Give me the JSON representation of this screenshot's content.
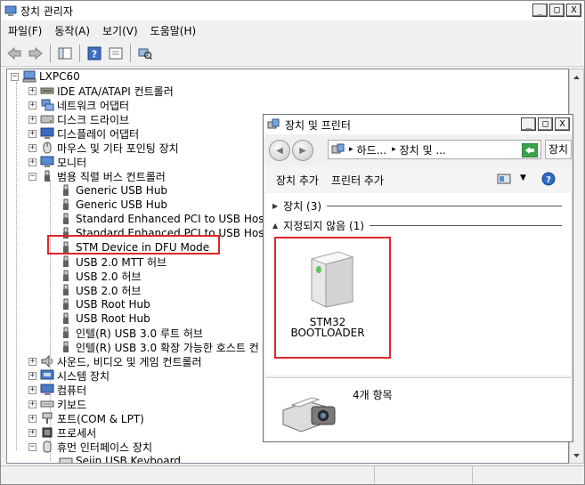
{
  "window": {
    "title": "장치 관리자"
  },
  "menu": [
    "파일(F)",
    "동작(A)",
    "보기(V)",
    "도움말(H)"
  ],
  "window_buttons": {
    "minimize": "_",
    "maximize": "□",
    "close": "X"
  },
  "tree": {
    "root": "LXPC60",
    "categories": [
      {
        "label": "IDE ATA/ATAPI 컨트롤러",
        "icon": "ide-controller-icon"
      },
      {
        "label": "네트워크 어댑터",
        "icon": "network-adapter-icon"
      },
      {
        "label": "디스크 드라이브",
        "icon": "disk-drive-icon"
      },
      {
        "label": "디스플레이 어댑터",
        "icon": "display-adapter-icon"
      },
      {
        "label": "마우스 및 기타 포인팅 장치",
        "icon": "mouse-icon"
      },
      {
        "label": "모니터",
        "icon": "monitor-icon"
      },
      {
        "label": "범용 직렬 버스 컨트롤러",
        "icon": "usb-controller-icon"
      }
    ],
    "usb_children": [
      "Generic USB Hub",
      "Generic USB Hub",
      "Standard Enhanced PCI to USB Host",
      "Standard Enhanced PCI to USB Host",
      "STM Device in DFU Mode",
      "USB 2.0 MTT 허브",
      "USB 2.0 허브",
      "USB 2.0 허브",
      "USB Root Hub",
      "USB Root Hub",
      "인텔(R) USB 3.0 루트 허브",
      "인텔(R) USB 3.0 확장 가능한 호스트 컨"
    ],
    "more_categories": [
      {
        "label": "사운드, 비디오 및 게임 컨트롤러",
        "icon": "sound-icon"
      },
      {
        "label": "시스템 장치",
        "icon": "system-device-icon"
      },
      {
        "label": "컴퓨터",
        "icon": "computer-icon"
      },
      {
        "label": "키보드",
        "icon": "keyboard-icon"
      },
      {
        "label": "포트(COM & LPT)",
        "icon": "port-icon"
      },
      {
        "label": "프로세서",
        "icon": "processor-icon"
      },
      {
        "label": "휴먼 인터페이스 장치",
        "icon": "hid-icon"
      }
    ],
    "hid_children": [
      "Seiin USB Keyboard"
    ]
  },
  "popup": {
    "title": "장치 및 프린터",
    "breadcrumb": [
      "하드...",
      "장치 및 ..."
    ],
    "search_text": "장치",
    "commands": [
      "장치 추가",
      "프린터 추가"
    ],
    "groups": [
      {
        "label": "장치 (3)"
      },
      {
        "label": "지정되지 않음 (1)"
      }
    ],
    "device_label_line1": "STM32",
    "device_label_line2": "BOOTLOADER",
    "item_count": "4개 항목"
  },
  "colors": {
    "highlight": "#e0262a",
    "title_blue": "#3a6ea5"
  }
}
